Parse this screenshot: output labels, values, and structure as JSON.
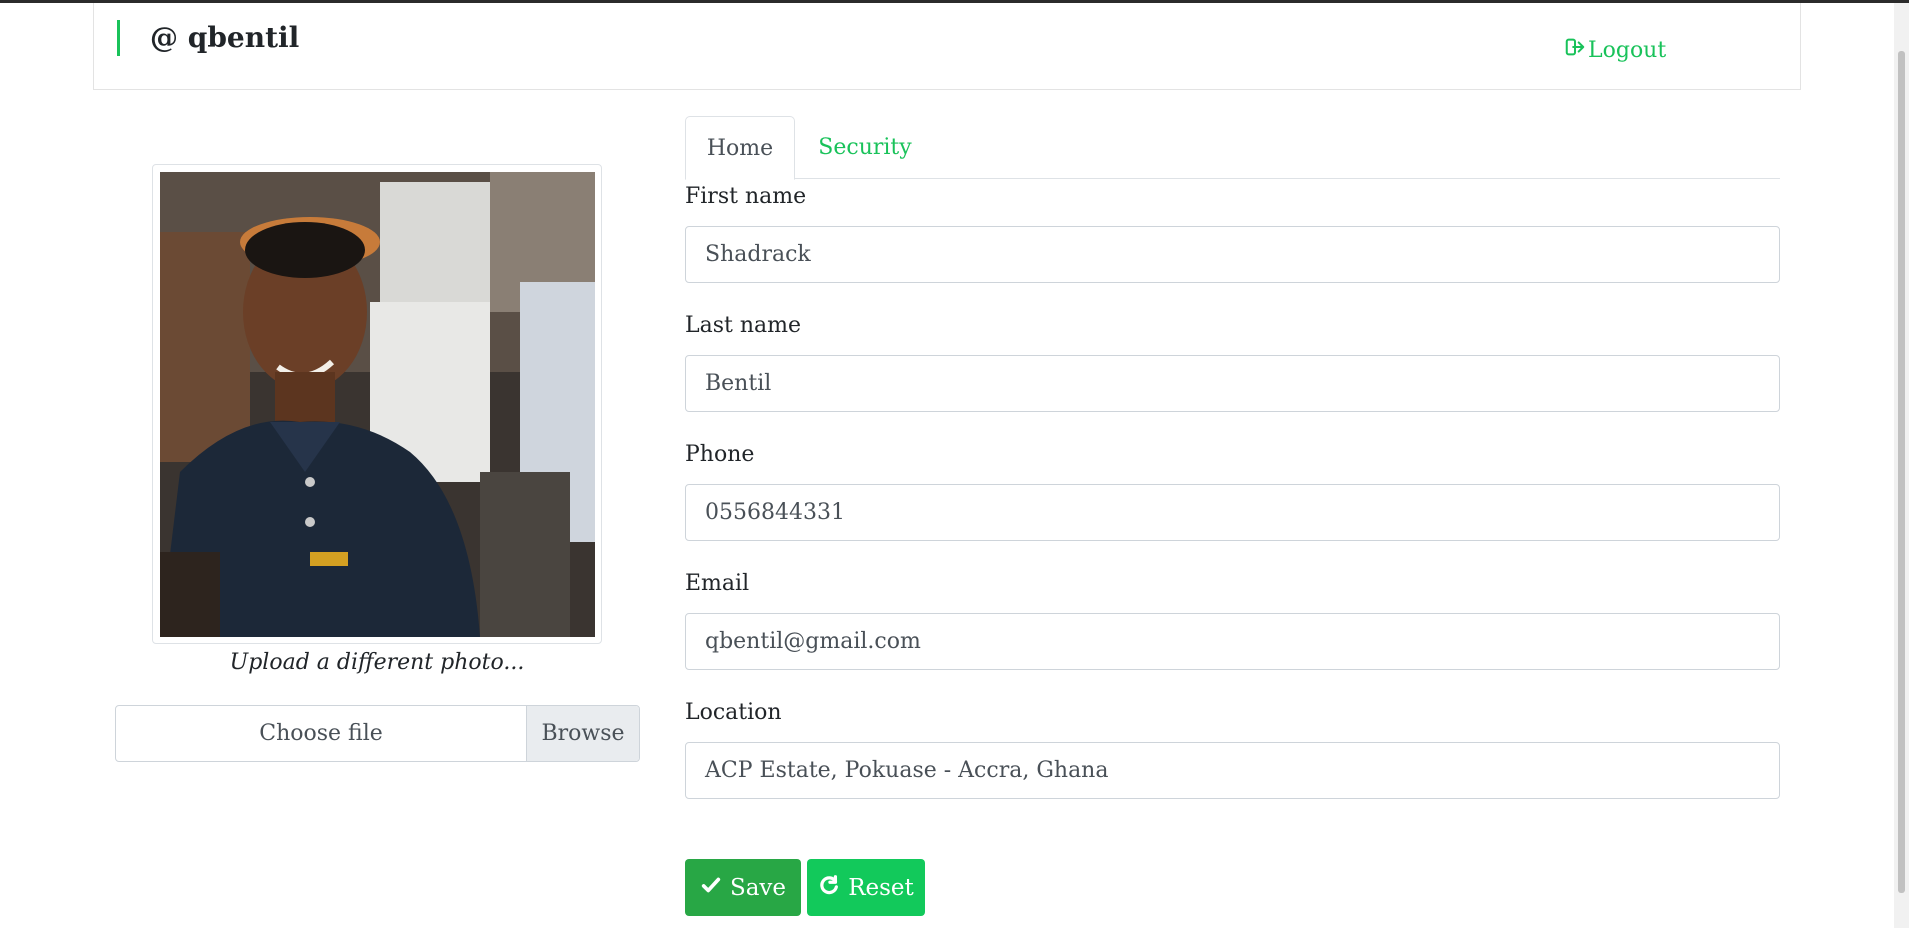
{
  "header": {
    "username": "@ qbentil",
    "logout_label": "Logout"
  },
  "profile": {
    "photo_caption": "Upload a different photo...",
    "file_input": {
      "placeholder": "Choose file",
      "browse_label": "Browse"
    }
  },
  "tabs": [
    {
      "label": "Home",
      "active": true
    },
    {
      "label": "Security",
      "active": false
    }
  ],
  "form": {
    "first_name": {
      "label": "First name",
      "value": "Shadrack"
    },
    "last_name": {
      "label": "Last name",
      "value": "Bentil"
    },
    "phone": {
      "label": "Phone",
      "value": "0556844331"
    },
    "email": {
      "label": "Email",
      "value": "qbentil@gmail.com"
    },
    "location": {
      "label": "Location",
      "value": "ACP Estate, Pokuase - Accra, Ghana"
    }
  },
  "actions": {
    "save_label": "Save",
    "reset_label": "Reset"
  },
  "colors": {
    "accent": "#19c25a",
    "save_button": "#28a745",
    "reset_button": "#12c95b"
  },
  "icons": {
    "logout": "sign-out-icon",
    "save": "check-icon",
    "reset": "refresh-icon"
  }
}
